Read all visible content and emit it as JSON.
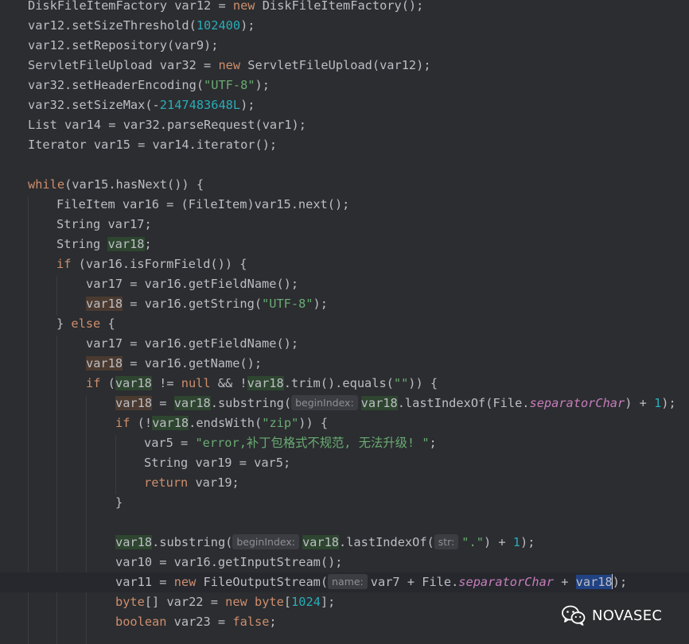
{
  "code": {
    "line1": [
      "DiskFileItemFactory var12 = ",
      "new",
      " DiskFileItemFactory();"
    ],
    "line2": [
      "var12.setSizeThreshold(",
      "102400",
      ");"
    ],
    "line3": "var12.setRepository(var9);",
    "line4": [
      "ServletFileUpload var32 = ",
      "new",
      " ServletFileUpload(var12);"
    ],
    "line5": [
      "var32.setHeaderEncoding(",
      "\"UTF-8\"",
      ");"
    ],
    "line6": [
      "var32.setSizeMax(-",
      "2147483648L",
      ");"
    ],
    "line7": "List var14 = var32.parseRequest(var1);",
    "line8": "Iterator var15 = var14.iterator();",
    "line10": [
      "while",
      "(var15.hasNext()) {"
    ],
    "line11": "FileItem var16 = (FileItem)var15.next();",
    "line12": "String var17;",
    "line13": [
      "String ",
      "var18",
      ";"
    ],
    "line14": [
      "if",
      " (var16.isFormField()) {"
    ],
    "line15": "var17 = var16.getFieldName();",
    "line16": [
      "var18",
      " = var16.getString(",
      "\"UTF-8\"",
      ");"
    ],
    "line17": [
      "} ",
      "else",
      " {"
    ],
    "line18": "var17 = var16.getFieldName();",
    "line19": [
      "var18",
      " = var16.getName();"
    ],
    "line20": [
      "if",
      " (",
      "var18",
      " != ",
      "null",
      " && !",
      "var18",
      ".trim().equals(",
      "\"\"",
      ")) {"
    ],
    "line21": [
      "var18",
      " = ",
      "var18",
      ".substring(",
      "beginIndex:",
      "var18",
      ".lastIndexOf(File.",
      "separatorChar",
      ") + ",
      "1",
      ");"
    ],
    "line22": [
      "if",
      " (!",
      "var18",
      ".endsWith(",
      "\"zip\"",
      ")) {"
    ],
    "line23": [
      "var5 = ",
      "\"error,补丁包格式不规范, 无法升级! \"",
      ";"
    ],
    "line24": "String var19 = var5;",
    "line25": [
      "return",
      " var19;"
    ],
    "line26": "}",
    "line28": [
      "var18",
      ".substring(",
      "beginIndex:",
      "var18",
      ".lastIndexOf(",
      "str:",
      "\".\"",
      ") + ",
      "1",
      ");"
    ],
    "line29": "var10 = var16.getInputStream();",
    "line30": [
      "var11 = ",
      "new",
      " FileOutputStream(",
      "name:",
      "var7 + File.",
      "separatorChar",
      " + ",
      "var18",
      ");"
    ],
    "line31": [
      "byte",
      "[] var22 = ",
      "new",
      " ",
      "byte",
      "[",
      "1024",
      "];"
    ],
    "line32": [
      "boolean",
      " var23 = ",
      "false",
      ";"
    ]
  },
  "watermark": {
    "icon": "wechat-icon",
    "text": "NOVASEC"
  },
  "colors": {
    "background": "#2b2d30",
    "keyword": "#cf8e6d",
    "number": "#2aacb8",
    "string": "#6aab73",
    "field": "#c77dbb",
    "text": "#bcbec4"
  }
}
